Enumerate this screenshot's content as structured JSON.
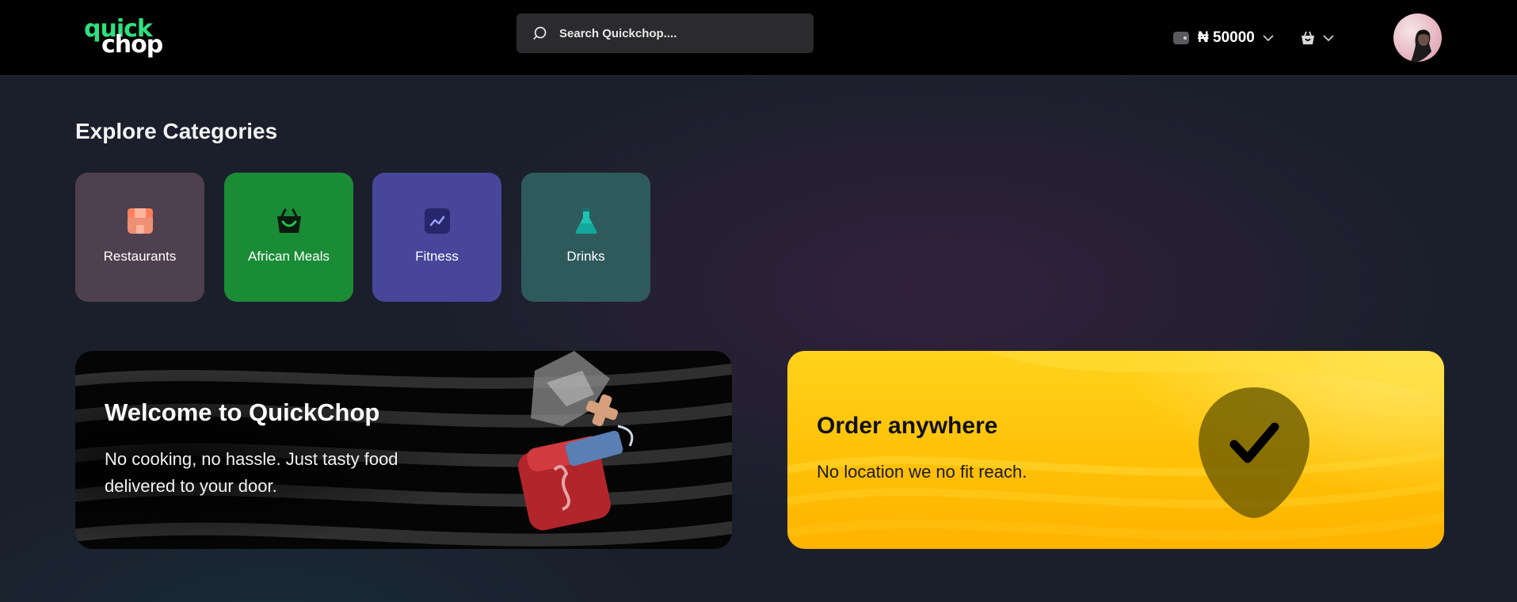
{
  "header": {
    "logo": {
      "line1": "quick",
      "line2": "chop"
    },
    "search": {
      "placeholder": "Search Quickchop...."
    },
    "wallet": {
      "amount": "₦ 50000"
    }
  },
  "categories": {
    "title": "Explore Categories",
    "items": [
      {
        "label": "Restaurants",
        "icon": "store-icon",
        "color": "#4f404f"
      },
      {
        "label": "African Meals",
        "icon": "basket-icon",
        "color": "#1a8c36"
      },
      {
        "label": "Fitness",
        "icon": "activity-chart-icon",
        "color": "#47469b"
      },
      {
        "label": "Drinks",
        "icon": "flask-icon",
        "color": "#2f5a5c"
      }
    ]
  },
  "banners": {
    "welcome": {
      "title": "Welcome to QuickChop",
      "subtitle": "No cooking, no hassle. Just tasty food delivered to your door."
    },
    "order": {
      "title": "Order anywhere",
      "subtitle": "No location we no fit reach."
    }
  },
  "colors": {
    "brand_green": "#2ee07f",
    "page_background": "#1b1f2b",
    "order_banner_yellow": "#ffc107"
  }
}
